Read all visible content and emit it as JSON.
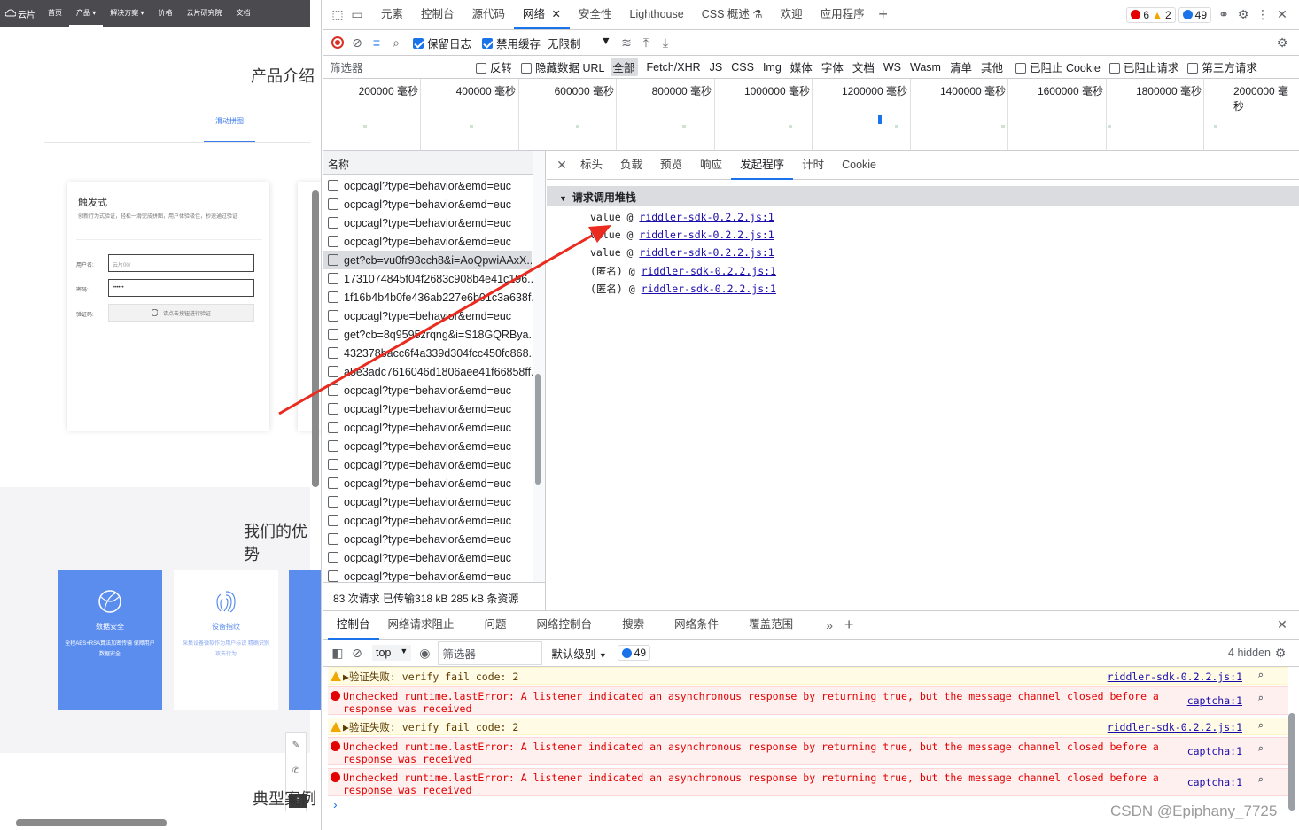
{
  "website": {
    "logo": "云片",
    "nav": [
      "首页",
      "产品 ▾",
      "解决方案 ▾",
      "价格",
      "云片研究院",
      "文档"
    ],
    "section_title": "产品介绍",
    "active_tab": "滑动拼图",
    "card": {
      "title": "触发式",
      "desc": "创新行为式验证，轻松一滑完成拼图，用户体验极佳，秒速通过验证",
      "username_label": "用户名:",
      "username_value": "云片00/",
      "password_label": "密码:",
      "password_value": "••••••",
      "captcha_label": "验证码:",
      "captcha_button": "请点击按钮进行验证"
    },
    "advantages_title": "我们的优势",
    "features": [
      {
        "title": "数据安全",
        "desc": "全程AES+RSA算法加密传输 保障用户数据安全"
      },
      {
        "title": "设备指纹",
        "desc": "采集设备微软作为用户标识 精确识别攻击行为"
      }
    ],
    "bottom_title": "典型案例"
  },
  "devtools": {
    "tabs": [
      "元素",
      "控制台",
      "源代码",
      "网络",
      "安全性",
      "Lighthouse",
      "CSS 概述",
      "欢迎",
      "应用程序"
    ],
    "active_tab": "网络",
    "error_count": "6",
    "warning_count": "2",
    "info_count": "49",
    "net_toolbar": {
      "preserve_log": "保留日志",
      "disable_cache": "禁用缓存",
      "throttle": "无限制"
    },
    "filter_bar": {
      "placeholder": "筛选器",
      "invert": "反转",
      "hide_data_urls": "隐藏数据 URL",
      "types": [
        "全部",
        "Fetch/XHR",
        "JS",
        "CSS",
        "Img",
        "媒体",
        "字体",
        "文档",
        "WS",
        "Wasm",
        "清单",
        "其他"
      ],
      "blocked_cookies": "已阻止 Cookie",
      "blocked_requests": "已阻止请求",
      "third_party": "第三方请求"
    },
    "timeline_ticks": [
      "200000 毫秒",
      "400000 毫秒",
      "600000 毫秒",
      "800000 毫秒",
      "1000000 毫秒",
      "1200000 毫秒",
      "1400000 毫秒",
      "1600000 毫秒",
      "1800000 毫秒",
      "2000000 毫秒"
    ],
    "request_list": {
      "header": "名称",
      "rows": [
        "ocpcagl?type=behavior&emd=euc",
        "ocpcagl?type=behavior&emd=euc",
        "ocpcagl?type=behavior&emd=euc",
        "ocpcagl?type=behavior&emd=euc",
        "get?cb=vu0fr93cch8&i=AoQpwiAAxX...",
        "1731074845f04f2683c908b4e41c196...",
        "1f16b4b4b0fe436ab227e6b01c3a638f...",
        "ocpcagl?type=behavior&emd=euc",
        "get?cb=8q9595zrqng&i=S18GQRBya...",
        "432378bacc6f4a339d304fcc450fc868...",
        "a5e3adc7616046d1806aee41f66858ff...",
        "ocpcagl?type=behavior&emd=euc",
        "ocpcagl?type=behavior&emd=euc",
        "ocpcagl?type=behavior&emd=euc",
        "ocpcagl?type=behavior&emd=euc",
        "ocpcagl?type=behavior&emd=euc",
        "ocpcagl?type=behavior&emd=euc",
        "ocpcagl?type=behavior&emd=euc",
        "ocpcagl?type=behavior&emd=euc",
        "ocpcagl?type=behavior&emd=euc",
        "ocpcagl?type=behavior&emd=euc",
        "ocpcagl?type=behavior&emd=euc"
      ],
      "selected_index": 4,
      "status": "83 次请求  已传输318 kB  285 kB 条资源"
    },
    "detail_tabs": [
      "标头",
      "负载",
      "预览",
      "响应",
      "发起程序",
      "计时",
      "Cookie"
    ],
    "detail_active": "发起程序",
    "stack_title": "请求调用堆栈",
    "stack": [
      {
        "fn": "value",
        "src": "riddler-sdk-0.2.2.js:1"
      },
      {
        "fn": "value",
        "src": "riddler-sdk-0.2.2.js:1"
      },
      {
        "fn": "value",
        "src": "riddler-sdk-0.2.2.js:1"
      },
      {
        "fn": "(匿名)",
        "src": "riddler-sdk-0.2.2.js:1"
      },
      {
        "fn": "(匿名)",
        "src": "riddler-sdk-0.2.2.js:1"
      }
    ],
    "drawer_tabs": [
      "控制台",
      "网络请求阻止",
      "问题",
      "网络控制台",
      "搜索",
      "网络条件",
      "覆盖范围"
    ],
    "drawer_active": "控制台",
    "console_toolbar": {
      "context": "top",
      "filter_placeholder": "筛选器",
      "levels": "默认级别",
      "issues": "49",
      "hidden": "4 hidden"
    },
    "console": [
      {
        "type": "warn",
        "text": "▶验证失败: verify fail code: 2",
        "src": "riddler-sdk-0.2.2.js:1"
      },
      {
        "type": "err",
        "text": "Unchecked runtime.lastError: A listener indicated an asynchronous response by returning true, but the message channel closed before a response was received",
        "src": "captcha:1"
      },
      {
        "type": "warn",
        "text": "▶验证失败: verify fail code: 2",
        "src": "riddler-sdk-0.2.2.js:1"
      },
      {
        "type": "err",
        "text": "Unchecked runtime.lastError: A listener indicated an asynchronous response by returning true, but the message channel closed before a response was received",
        "src": "captcha:1"
      },
      {
        "type": "err",
        "text": "Unchecked runtime.lastError: A listener indicated an asynchronous response by returning true, but the message channel closed before a response was received",
        "src": "captcha:1"
      }
    ],
    "prompt": "›"
  },
  "watermark": "CSDN @Epiphany_7725",
  "colors": {
    "accent": "#1a73e8",
    "feature_blue": "#5b8def",
    "error": "#e40000",
    "warn": "#f2a600"
  }
}
